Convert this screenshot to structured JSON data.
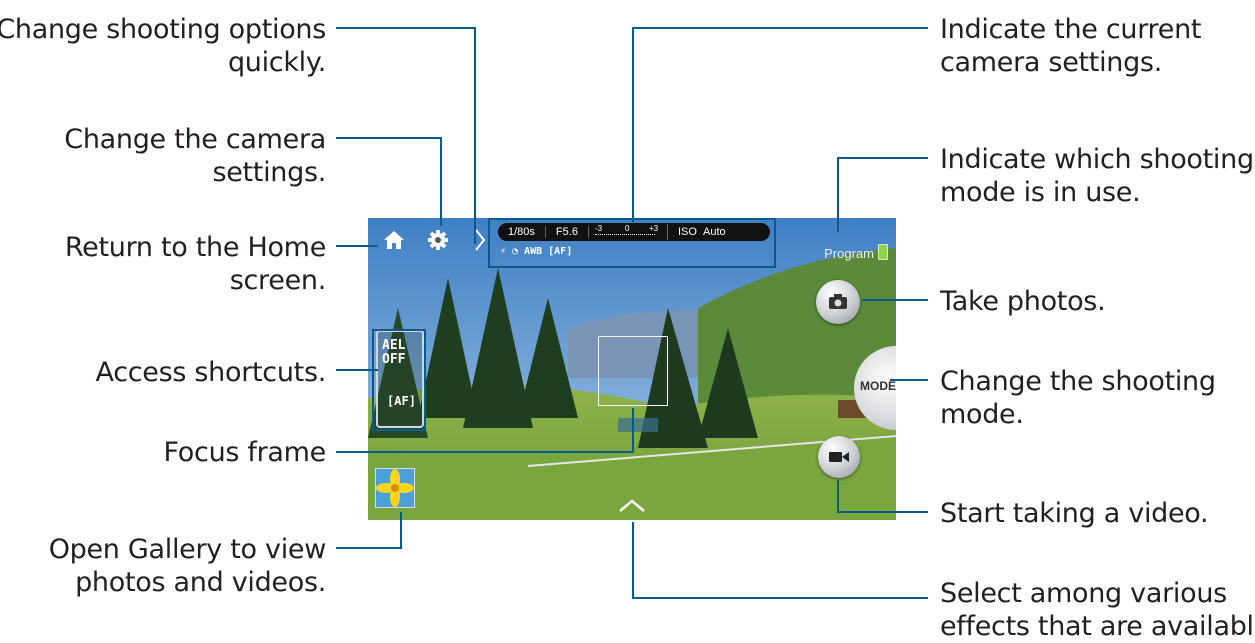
{
  "callouts": {
    "shooting_options": "Change shooting options\nquickly.",
    "camera_settings": "Change the camera\nsettings.",
    "home": "Return to the Home\nscreen.",
    "shortcuts": "Access shortcuts.",
    "focus": "Focus frame",
    "gallery": "Open Gallery to view\nphotos and videos.",
    "current_settings": "Indicate the current\ncamera settings.",
    "shooting_mode": "Indicate which shooting\nmode is in use.",
    "take_photos": "Take photos.",
    "change_mode": "Change the shooting\nmode.",
    "video": "Start taking a video.",
    "effects": "Select among various\neffects that are available."
  },
  "camera": {
    "shutter": "1/80s",
    "aperture": "F5.6",
    "ev_min": "-3",
    "ev_mid": "0",
    "ev_max": "+3",
    "iso_label": "ISO",
    "iso_value": "Auto",
    "icon_row": [
      "flash-off-icon",
      "timer-icon",
      "AWB",
      "AF"
    ],
    "awb": "AWB",
    "af": "AF",
    "mode_label": "Program",
    "mode_button": "MODE",
    "ael": "AEL",
    "off": "OFF",
    "shortcut_af": "AF"
  },
  "colors": {
    "callout_line": "#0a5a8c",
    "battery": "#8fd14a"
  }
}
